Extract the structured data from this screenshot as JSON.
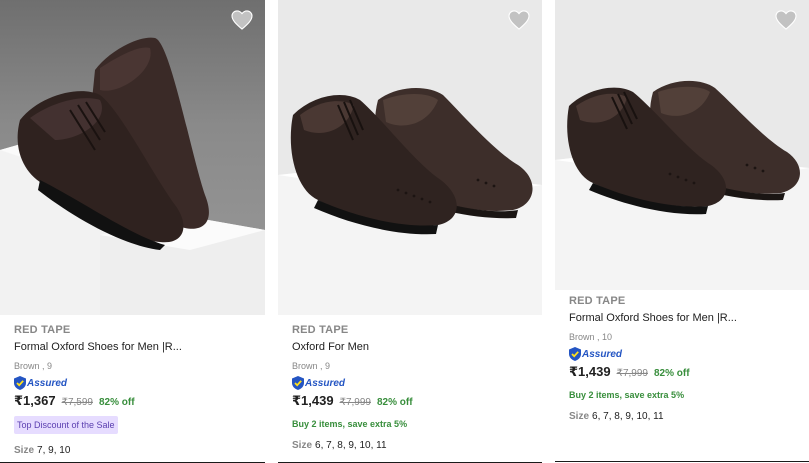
{
  "products": [
    {
      "brand": "RED TAPE",
      "title": "Formal Oxford Shoes for Men |R...",
      "variant": "Brown , 9",
      "assured": "Assured",
      "price": "₹1,367",
      "mrp": "₹7,599",
      "discount": "82% off",
      "tag": "Top Discount of the Sale",
      "size_label": "Size",
      "sizes": "7, 9, 10",
      "wishlist_icon": "heart-icon"
    },
    {
      "brand": "RED TAPE",
      "title": "Oxford For Men",
      "variant": "Brown , 9",
      "assured": "Assured",
      "price": "₹1,439",
      "mrp": "₹7,999",
      "discount": "82% off",
      "offer": "Buy 2 items, save extra 5%",
      "size_label": "Size",
      "sizes": "6, 7, 8, 9, 10, 11",
      "wishlist_icon": "heart-icon"
    },
    {
      "brand": "RED TAPE",
      "title": "Formal Oxford Shoes for Men |R...",
      "variant": "Brown , 10",
      "assured": "Assured",
      "price": "₹1,439",
      "mrp": "₹7,999",
      "discount": "82% off",
      "offer": "Buy 2 items, save extra 5%",
      "size_label": "Size",
      "sizes": "6, 7, 8, 9, 10, 11",
      "wishlist_icon": "heart-icon"
    }
  ],
  "colors": {
    "price_off": "#388e3c",
    "assured": "#2455c3",
    "muted": "#878787",
    "tag_bg": "#e6dcff"
  }
}
